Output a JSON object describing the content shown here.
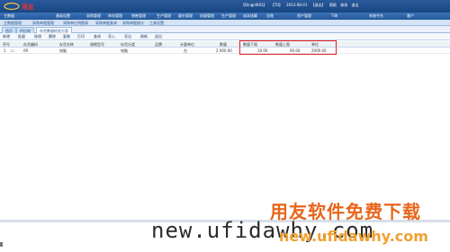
{
  "colors": {
    "header_blue": "#1f4f8c",
    "highlight_red": "#e02020",
    "watermark_orange": "#e8651b"
  },
  "header": {
    "logo_text": "用友",
    "info": [
      "【Dingid001】",
      "【T0】",
      "2013-08-01",
      "【退出】",
      "帮助",
      "修改",
      "退出"
    ]
  },
  "menu": [
    "主数据",
    "基础设置",
    "采购管理",
    "库存管理",
    "销售管理",
    "生产管理",
    "委外管理",
    "质量管理",
    "生产管理",
    "成本核算",
    "总账",
    "资产管理",
    "T-BI",
    "系统平台",
    "客户"
  ],
  "submenu": [
    "主数据管理",
    "采购单据管理",
    "采购单位明细表",
    "采购单据查询",
    "采购单据统计",
    "工具设置"
  ],
  "tabs": [
    {
      "label": "首页"
    },
    {
      "label": "供应商"
    },
    {
      "label": "存货数量检验方案"
    }
  ],
  "toolbar": [
    "新增",
    "批量",
    "修改",
    "删除",
    "复制",
    "打印",
    "查询",
    "导入",
    "导出",
    "刷新",
    "退出"
  ],
  "grid": {
    "headers": [
      "序号",
      "存货编码",
      "存货名称",
      "规格型号",
      "存货分类",
      "品牌",
      "计量单位",
      "数量",
      "数量下限",
      "数量上限",
      "单位"
    ],
    "rows": [
      {
        "no": "1",
        "code": "09",
        "name": "电脑",
        "spec": "",
        "category": "电脑",
        "brand": "",
        "unit": "台",
        "qty": "2.000.00",
        "min": "10.00",
        "max": "90.00",
        "unit2": "2000.00"
      }
    ]
  },
  "watermark": {
    "cn": "用友软件免费下载",
    "url_dark": "new.ufidawhy.com",
    "url_color": "new.ufidawhy.com"
  }
}
